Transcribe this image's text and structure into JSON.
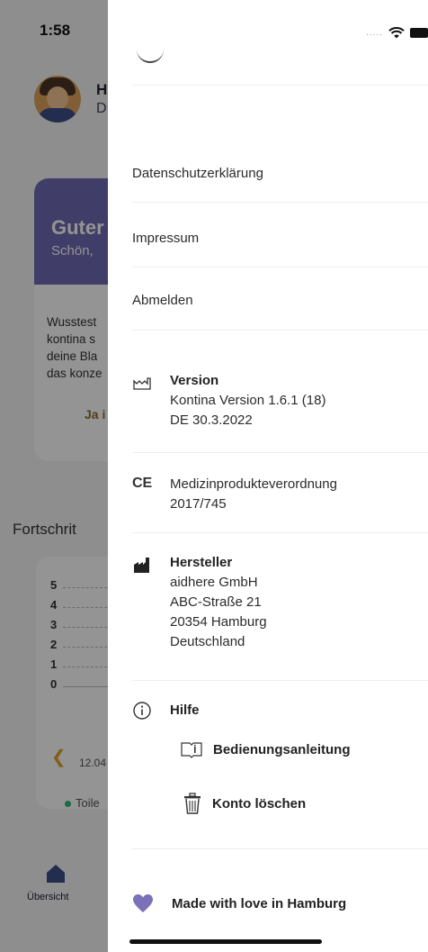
{
  "status_bar": {
    "time": "1:58"
  },
  "background": {
    "user_initial": "H",
    "user_sub_initial": "D",
    "card_title": "Guter",
    "card_subtitle": "Schön,",
    "card_text_lines": [
      "Wusstest",
      "kontina s",
      "deine Bla",
      "das konze"
    ],
    "card_button": "Ja i",
    "progress_title": "Fortschrit",
    "chart_ticks": [
      "5",
      "4",
      "3",
      "2",
      "1",
      "0"
    ],
    "chart_date": "12.04",
    "legend": "Toile",
    "tab_label": "Übersicht"
  },
  "drawer": {
    "links": [
      {
        "label": "Datenschutzerklärung"
      },
      {
        "label": "Impressum"
      },
      {
        "label": "Abmelden"
      }
    ],
    "version": {
      "heading": "Version",
      "line1": "Kontina Version 1.6.1 (18)",
      "line2": "DE 30.3.2022"
    },
    "regulation": {
      "icon": "CE",
      "line1": "Medizinprodukteverordnung",
      "line2": "2017/745"
    },
    "manufacturer": {
      "heading": "Hersteller",
      "line1": "aidhere GmbH",
      "line2": "ABC-Straße 21",
      "line3": "20354 Hamburg",
      "line4": "Deutschland"
    },
    "help": {
      "heading": "Hilfe",
      "manual_label": "Bedienungsanleitung",
      "delete_label": "Konto löschen"
    },
    "footer": {
      "label": "Made with love in Hamburg",
      "heart_color": "#7a71b8"
    }
  }
}
